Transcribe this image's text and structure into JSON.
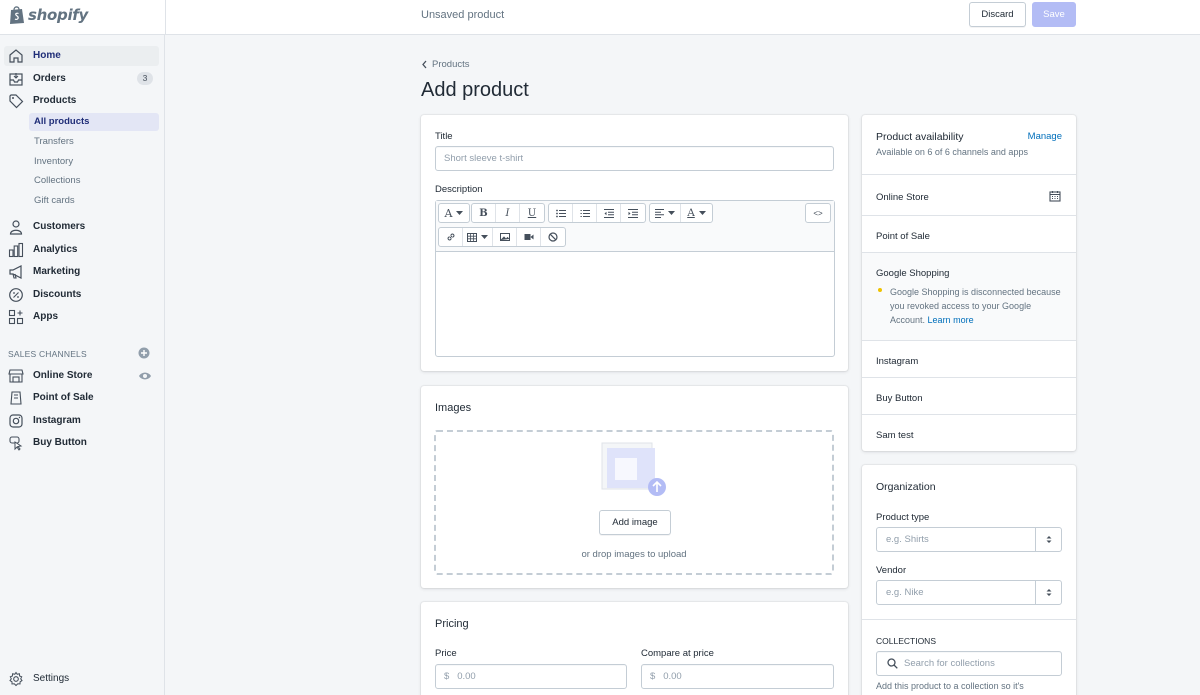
{
  "brand": {
    "name": "shopify"
  },
  "topbar": {
    "title": "Unsaved product",
    "discard_label": "Discard",
    "save_label": "Save"
  },
  "sidebar": {
    "items": [
      {
        "label": "Home",
        "icon": "home-icon"
      },
      {
        "label": "Orders",
        "icon": "orders-icon",
        "badge": "3"
      },
      {
        "label": "Products",
        "icon": "tag-icon"
      }
    ],
    "products_sub": [
      "All products",
      "Transfers",
      "Inventory",
      "Collections",
      "Gift cards"
    ],
    "items2": [
      {
        "label": "Customers",
        "icon": "person-icon"
      },
      {
        "label": "Analytics",
        "icon": "bar-chart-icon"
      },
      {
        "label": "Marketing",
        "icon": "megaphone-icon"
      },
      {
        "label": "Discounts",
        "icon": "discount-icon"
      },
      {
        "label": "Apps",
        "icon": "apps-icon"
      }
    ],
    "sales_channels_heading": "SALES CHANNELS",
    "channels": [
      {
        "label": "Online Store",
        "icon": "store-icon"
      },
      {
        "label": "Point of Sale",
        "icon": "pos-icon"
      },
      {
        "label": "Instagram",
        "icon": "instagram-icon"
      },
      {
        "label": "Buy Button",
        "icon": "buy-button-icon"
      }
    ],
    "settings_label": "Settings"
  },
  "main": {
    "breadcrumb": "Products",
    "page_title": "Add product",
    "title_label": "Title",
    "title_placeholder": "Short sleeve t-shirt",
    "description_label": "Description",
    "images_heading": "Images",
    "add_image_label": "Add image",
    "drop_hint": "or drop images to upload",
    "pricing_heading": "Pricing",
    "price_label": "Price",
    "compare_label": "Compare at price",
    "currency_symbol": "$",
    "price_placeholder": "0.00",
    "compare_placeholder": "0.00"
  },
  "availability": {
    "heading": "Product availability",
    "manage_label": "Manage",
    "subtitle": "Available on 6 of 6 channels and apps",
    "channels": [
      "Online Store",
      "Point of Sale",
      "Google Shopping",
      "Instagram",
      "Buy Button",
      "Sam test"
    ],
    "google_warning": "Google Shopping is disconnected because you revoked access to your Google Account.",
    "learn_more": "Learn more"
  },
  "organization": {
    "heading": "Organization",
    "product_type_label": "Product type",
    "product_type_placeholder": "e.g. Shirts",
    "vendor_label": "Vendor",
    "vendor_placeholder": "e.g. Nike",
    "collections_heading": "COLLECTIONS",
    "collections_search_placeholder": "Search for collections",
    "collections_hint": "Add this product to a collection so it's"
  },
  "colors": {
    "accent": "#5c6ac4",
    "save_disabled": "#b3bcf5",
    "link": "#006fbb",
    "warning_dot": "#eec200"
  }
}
